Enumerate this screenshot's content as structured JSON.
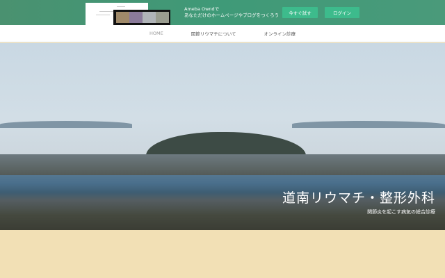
{
  "banner": {
    "line1": "Ameba Owndで",
    "line2": "あなただけのホームページやブログをつくろう",
    "try_label": "今すぐ試す",
    "login_label": "ログイン",
    "colors": {
      "bg": "#3f9a78",
      "button": "#3dbb8c"
    }
  },
  "nav": {
    "items": [
      {
        "label": "HOME"
      },
      {
        "label": "関節リウマチについて"
      },
      {
        "label": "オンライン診療"
      }
    ]
  },
  "hero": {
    "title": "道南リウマチ・整形外科",
    "subtitle": "関節炎を起こす病気の総合診療"
  }
}
